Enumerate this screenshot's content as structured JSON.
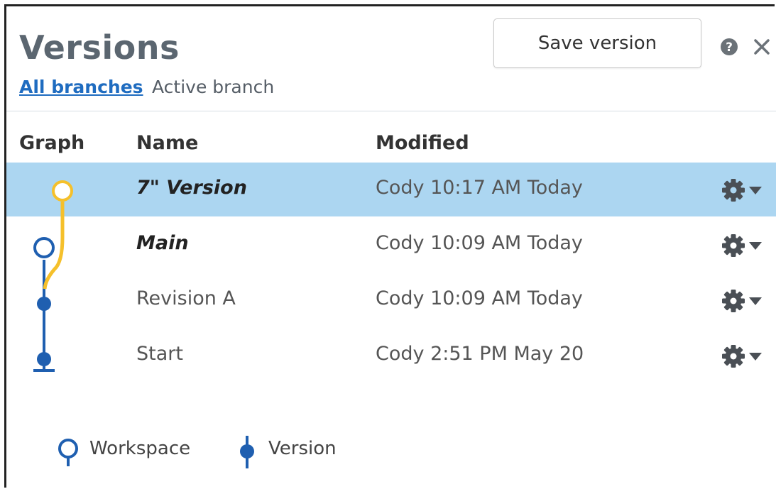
{
  "header": {
    "title": "Versions",
    "tab_all": "All branches",
    "tab_active": "Active branch",
    "save_label": "Save version"
  },
  "columns": {
    "graph": "Graph",
    "name": "Name",
    "modified": "Modified"
  },
  "rows": [
    {
      "name": "7\" Version",
      "modified": "Cody 10:17 AM Today",
      "type": "workspace",
      "branch": "yellow",
      "selected": true
    },
    {
      "name": "Main",
      "modified": "Cody 10:09 AM Today",
      "type": "workspace",
      "branch": "blue",
      "selected": false
    },
    {
      "name": "Revision A",
      "modified": "Cody 10:09 AM Today",
      "type": "version",
      "branch": "blue",
      "selected": false
    },
    {
      "name": "Start",
      "modified": "Cody 2:51 PM May 20",
      "type": "version",
      "branch": "blue",
      "selected": false
    }
  ],
  "legend": {
    "workspace": "Workspace",
    "version": "Version"
  },
  "colors": {
    "accent": "#1f6cc0",
    "selected_row": "#acd6f1",
    "branch_blue": "#1f5fb0",
    "branch_yellow": "#f5c02b"
  },
  "icons": {
    "help": "help-icon",
    "close": "close-icon",
    "gear": "gear-icon"
  }
}
